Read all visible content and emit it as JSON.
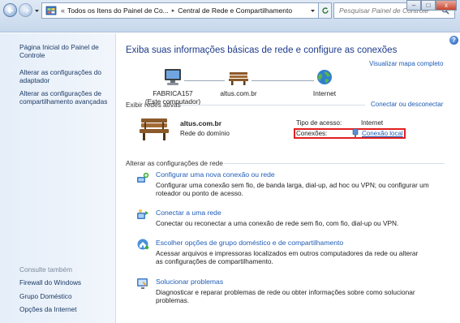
{
  "breadcrumb": {
    "overflow": "«",
    "items": [
      "Todos os Itens do Painel de Co...",
      "Central de Rede e Compartilhamento"
    ]
  },
  "search": {
    "placeholder": "Pesquisar Painel de Controle"
  },
  "window_buttons": {
    "minimize": "–",
    "maximize": "□",
    "close": "x"
  },
  "help": "?",
  "sidebar": {
    "links": [
      "Página Inicial do Painel de Controle",
      "Alterar as configurações do adaptador",
      "Alterar as configurações de compartilhamento avançadas"
    ],
    "see_also_label": "Consulte também",
    "see_also": [
      "Firewall do Windows",
      "Grupo Doméstico",
      "Opções da Internet"
    ]
  },
  "main": {
    "title": "Exiba suas informações básicas de rede e configure as conexões",
    "view_full_map": "Visualizar mapa completo",
    "map": {
      "computer_name": "FABRICA157",
      "computer_sub": "(Este computador)",
      "network_name": "altus.com.br",
      "internet": "Internet"
    },
    "active_networks_label": "Exibir redes ativas",
    "connect_disconnect": "Conectar ou desconectar",
    "active_network": {
      "name": "altus.com.br",
      "type": "Rede do domínio",
      "access_type_label": "Tipo de acesso:",
      "access_type_value": "Internet",
      "connections_label": "Conexões:",
      "connections_value": "Conexão local"
    },
    "change_settings_label": "Alterar as configurações de rede",
    "tasks": [
      {
        "title": "Configurar uma nova conexão ou rede",
        "desc": "Configurar uma conexão sem fio, de banda larga, dial-up, ad hoc ou VPN; ou configurar um roteador ou ponto de acesso."
      },
      {
        "title": "Conectar a uma rede",
        "desc": "Conectar ou reconectar a uma conexão de rede sem fio, com fio, dial-up ou VPN."
      },
      {
        "title": "Escolher opções de grupo doméstico e de compartilhamento",
        "desc": "Acessar arquivos e impressoras localizados em outros computadores da rede ou alterar as configurações de compartilhamento."
      },
      {
        "title": "Solucionar problemas",
        "desc": "Diagnosticar e reparar problemas de rede ou obter informações sobre como solucionar problemas."
      }
    ]
  },
  "colors": {
    "link": "#1f5cb5",
    "title": "#1e3b8a",
    "highlight_box": "#e11f1f"
  }
}
